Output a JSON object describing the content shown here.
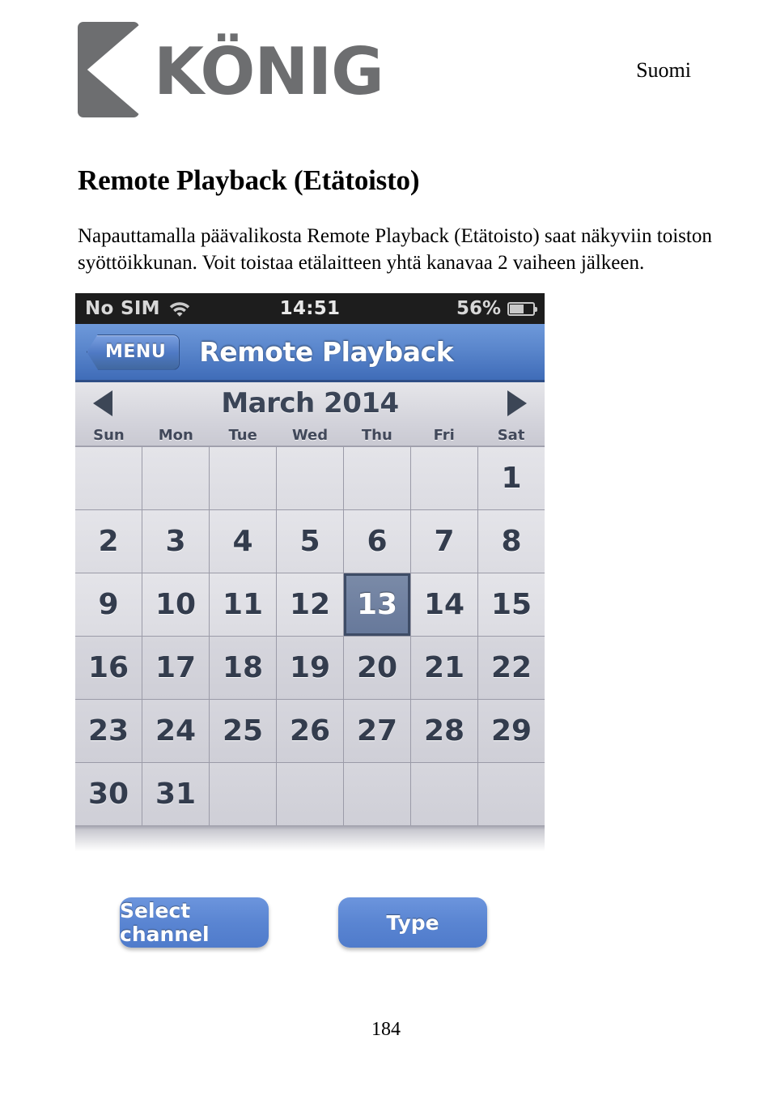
{
  "document": {
    "language_label": "Suomi",
    "brand": "KÖNIG",
    "title": "Remote Playback (Etätoisto)",
    "paragraph": "Napauttamalla päävalikosta Remote Playback (Etätoisto) saat näkyviin toiston syöttöikkunan. Voit toistaa etälaitteen yhtä kanavaa 2 vaiheen jälkeen.",
    "page_number": "184"
  },
  "screenshot": {
    "status_bar": {
      "carrier": "No SIM",
      "wifi_icon": "wifi-icon",
      "time": "14:51",
      "battery_percent": "56%",
      "battery_icon": "battery-icon",
      "battery_level": 56
    },
    "nav_bar": {
      "back_label": "MENU",
      "title": "Remote Playback"
    },
    "calendar": {
      "prev_icon": "triangle-left-icon",
      "next_icon": "triangle-right-icon",
      "month_label": "March 2014",
      "weekdays": [
        "Sun",
        "Mon",
        "Tue",
        "Wed",
        "Thu",
        "Fri",
        "Sat"
      ],
      "cells": [
        {
          "label": "",
          "state": "empty"
        },
        {
          "label": "",
          "state": "empty"
        },
        {
          "label": "",
          "state": "empty"
        },
        {
          "label": "",
          "state": "empty"
        },
        {
          "label": "",
          "state": "empty"
        },
        {
          "label": "",
          "state": "empty"
        },
        {
          "label": "1",
          "state": "normal"
        },
        {
          "label": "2",
          "state": "normal"
        },
        {
          "label": "3",
          "state": "normal"
        },
        {
          "label": "4",
          "state": "normal"
        },
        {
          "label": "5",
          "state": "normal"
        },
        {
          "label": "6",
          "state": "normal"
        },
        {
          "label": "7",
          "state": "normal"
        },
        {
          "label": "8",
          "state": "normal"
        },
        {
          "label": "9",
          "state": "normal"
        },
        {
          "label": "10",
          "state": "normal"
        },
        {
          "label": "11",
          "state": "normal"
        },
        {
          "label": "12",
          "state": "normal"
        },
        {
          "label": "13",
          "state": "selected"
        },
        {
          "label": "14",
          "state": "normal"
        },
        {
          "label": "15",
          "state": "normal"
        },
        {
          "label": "16",
          "state": "dim"
        },
        {
          "label": "17",
          "state": "dim"
        },
        {
          "label": "18",
          "state": "dim"
        },
        {
          "label": "19",
          "state": "dim"
        },
        {
          "label": "20",
          "state": "dim"
        },
        {
          "label": "21",
          "state": "dim"
        },
        {
          "label": "22",
          "state": "dim"
        },
        {
          "label": "23",
          "state": "dim"
        },
        {
          "label": "24",
          "state": "dim"
        },
        {
          "label": "25",
          "state": "dim"
        },
        {
          "label": "26",
          "state": "dim"
        },
        {
          "label": "27",
          "state": "dim"
        },
        {
          "label": "28",
          "state": "dim"
        },
        {
          "label": "29",
          "state": "dim"
        },
        {
          "label": "30",
          "state": "dim"
        },
        {
          "label": "31",
          "state": "dim"
        },
        {
          "label": "",
          "state": "empty-dim"
        },
        {
          "label": "",
          "state": "empty-dim"
        },
        {
          "label": "",
          "state": "empty-dim"
        },
        {
          "label": "",
          "state": "empty-dim"
        },
        {
          "label": "",
          "state": "empty-dim"
        }
      ],
      "selected_day": "13"
    }
  },
  "buttons": {
    "select_channel": "Select channel",
    "type": "Type"
  },
  "colors": {
    "navbar_blue": "#5a86cc",
    "button_blue": "#5a85d2",
    "selected_day_blue": "#66789a",
    "logo_gray": "#6d6e70"
  }
}
